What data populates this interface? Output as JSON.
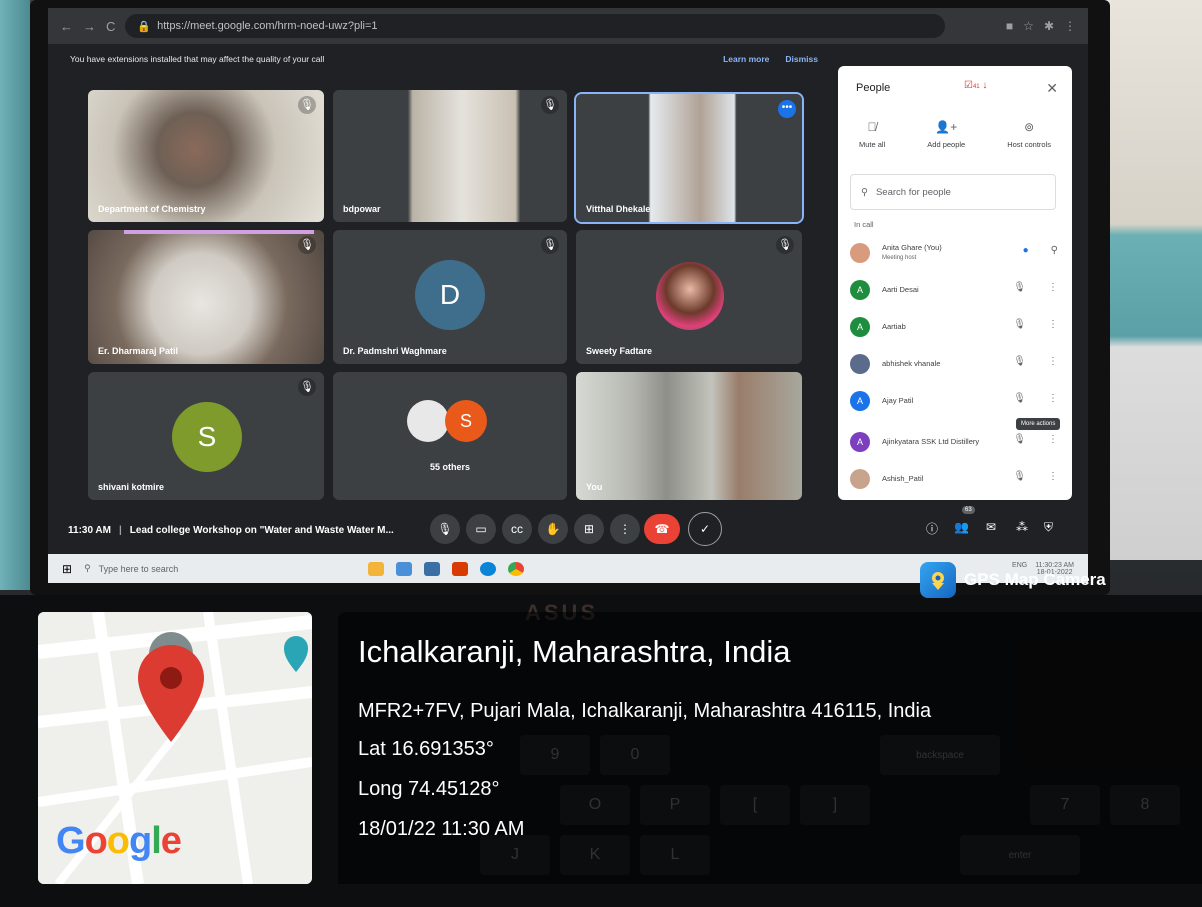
{
  "browser": {
    "url": "https://meet.google.com/hrm-noed-uwz?pli=1"
  },
  "warning": {
    "text": "You have extensions installed that may affect the quality of your call",
    "learn_more": "Learn more",
    "dismiss": "Dismiss"
  },
  "tiles": [
    {
      "name": "Department of Chemistry",
      "kind": "video"
    },
    {
      "name": "bdpowar",
      "kind": "video"
    },
    {
      "name": "Vitthal Dhekale",
      "kind": "video"
    },
    {
      "name": "Er. Dharmaraj Patil",
      "kind": "video"
    },
    {
      "name": "Dr. Padmshri Waghmare",
      "kind": "avatar",
      "initial": "D",
      "color": "#3f6e8c"
    },
    {
      "name": "Sweety Fadtare",
      "kind": "photo"
    },
    {
      "name": "shivani kotmire",
      "kind": "avatar",
      "initial": "S",
      "color": "#7e9b2b"
    },
    {
      "name": "",
      "kind": "others",
      "initial": "S",
      "color": "#e8591a",
      "label": "55 others"
    },
    {
      "name": "You",
      "kind": "video"
    }
  ],
  "panel": {
    "title": "People",
    "badge_count": "41",
    "close": "✕",
    "host_actions": [
      {
        "label": "Mute all",
        "icon": "mic-off-icon"
      },
      {
        "label": "Add people",
        "icon": "person-add-icon"
      },
      {
        "label": "Host controls",
        "icon": "toggle-icon"
      }
    ],
    "search_placeholder": "Search for people",
    "section": "In call",
    "people": [
      {
        "name": "Anita Ghare (You)",
        "sub": "Meeting host",
        "initial": "",
        "color": "#d89b7e"
      },
      {
        "name": "Aarti Desai",
        "sub": "",
        "initial": "A",
        "color": "#1e8e3e"
      },
      {
        "name": "Aartiab",
        "sub": "",
        "initial": "A",
        "color": "#1e8e3e"
      },
      {
        "name": "abhishek vhanale",
        "sub": "",
        "initial": "",
        "color": "#5a6b8c"
      },
      {
        "name": "Ajay Patil",
        "sub": "",
        "initial": "A",
        "color": "#1a73e8"
      },
      {
        "name": "Ajinkyatara SSK Ltd Distillery",
        "sub": "",
        "initial": "A",
        "color": "#7b3fbf"
      },
      {
        "name": "Ashish_Patil",
        "sub": "",
        "initial": "",
        "color": "#c9a48c"
      }
    ],
    "tooltip": "More actions"
  },
  "meeting": {
    "time": "11:30 AM",
    "separator": "|",
    "title": "Lead college Workshop on \"Water and Waste Water M...",
    "participant_count": "63"
  },
  "taskbar": {
    "search_placeholder": "Type here to search",
    "clock_time": "11:30:23 AM",
    "clock_date": "18-01-2022",
    "lang": "ENG"
  },
  "laptop_brand": "ASUS",
  "gps": {
    "app_name": "GPS Map Camera",
    "place": "Ichalkaranji, Maharashtra, India",
    "address": "MFR2+7FV, Pujari Mala, Ichalkaranji, Maharashtra 416115, India",
    "lat": "Lat 16.691353°",
    "long": "Long 74.45128°",
    "datetime": "18/01/22 11:30 AM",
    "map_brand": "Google",
    "colors": {
      "pin": "#db3b30",
      "map_road": "#ffffff",
      "map_bg": "#f1f1ef"
    }
  }
}
